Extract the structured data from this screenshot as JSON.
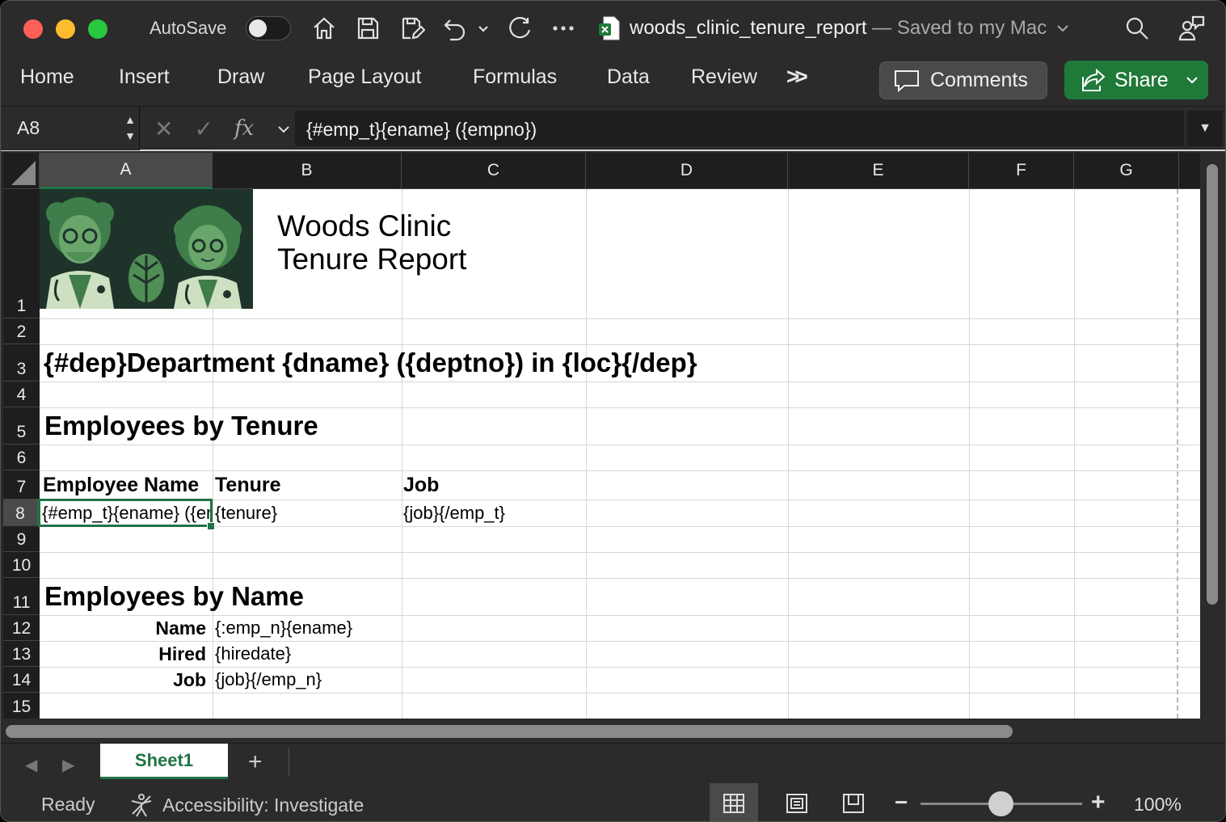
{
  "titlebar": {
    "autosave_label": "AutoSave",
    "doc_name": "woods_clinic_tenure_report",
    "doc_status": " — Saved to my Mac"
  },
  "ribbon": {
    "tabs": [
      "Home",
      "Insert",
      "Draw",
      "Page Layout",
      "Formulas",
      "Data",
      "Review"
    ],
    "comments_label": "Comments",
    "share_label": "Share"
  },
  "formula_bar": {
    "name_box": "A8",
    "fx": "fx",
    "formula": "{#emp_t}{ename} ({empno})"
  },
  "grid": {
    "columns": [
      "A",
      "B",
      "C",
      "D",
      "E",
      "F",
      "G"
    ],
    "selected_column": "A",
    "rows": [
      "1",
      "2",
      "3",
      "4",
      "5",
      "6",
      "7",
      "8",
      "9",
      "10",
      "11",
      "12",
      "13",
      "14",
      "15"
    ],
    "selected_row": "8",
    "cells": {
      "C1_line1": "Woods Clinic",
      "C1_line2": "Tenure Report",
      "A3": "{#dep}Department {dname} ({deptno}) in {loc}{/dep}",
      "A5": "Employees by Tenure",
      "A7": "Employee Name",
      "B7": "Tenure",
      "C7": "Job",
      "A8": "{#emp_t}{ename} ({empno})",
      "B8": "{tenure}",
      "C8": "{job}{/emp_t}",
      "A11": "Employees by Name",
      "A12": "Name",
      "B12": "{:emp_n}{ename}",
      "A13": "Hired",
      "B13": "{hiredate}",
      "A14": "Job",
      "B14": "{job}{/emp_n}"
    }
  },
  "sheets": {
    "tabs": [
      "Sheet1"
    ],
    "active": "Sheet1"
  },
  "status": {
    "ready": "Ready",
    "accessibility": "Accessibility: Investigate",
    "zoom": "100%"
  },
  "colors": {
    "accent": "#217346",
    "share": "#1f7a3a",
    "logo_bg": "#1e3329"
  }
}
